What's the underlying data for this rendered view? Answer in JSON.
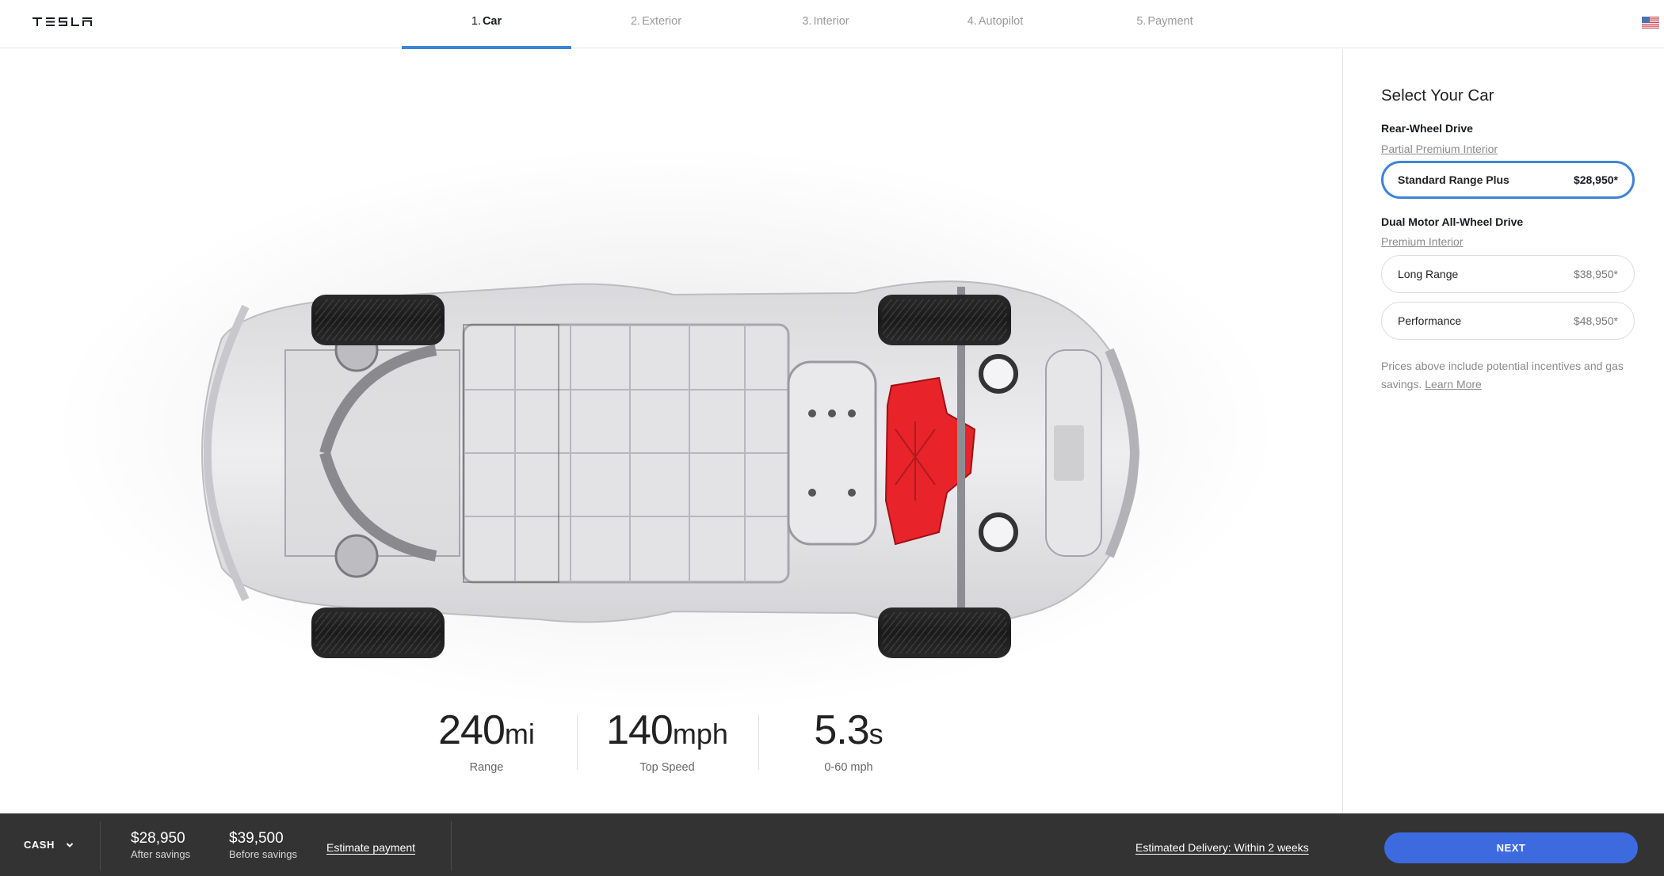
{
  "header": {
    "logo_text": "TESLA",
    "tabs": [
      {
        "num": "1.",
        "label": "Car",
        "active": true
      },
      {
        "num": "2.",
        "label": "Exterior",
        "active": false
      },
      {
        "num": "3.",
        "label": "Interior",
        "active": false
      },
      {
        "num": "4.",
        "label": "Autopilot",
        "active": false
      },
      {
        "num": "5.",
        "label": "Payment",
        "active": false
      }
    ],
    "region_icon": "us-flag-icon"
  },
  "main": {
    "image_alt": "Model 3 chassis top view with rear motor highlighted",
    "stats": [
      {
        "value": "240",
        "unit": "mi",
        "label": "Range"
      },
      {
        "value": "140",
        "unit": "mph",
        "label": "Top Speed"
      },
      {
        "value": "5.3",
        "unit": "s",
        "label": "0-60 mph"
      }
    ]
  },
  "sidebar": {
    "title": "Select Your Car",
    "groups": [
      {
        "heading": "Rear-Wheel Drive",
        "link": "Partial Premium Interior",
        "options": [
          {
            "name": "Standard Range Plus",
            "price": "$28,950*",
            "selected": true
          }
        ]
      },
      {
        "heading": "Dual Motor All-Wheel Drive",
        "link": "Premium Interior",
        "options": [
          {
            "name": "Long Range",
            "price": "$38,950*",
            "selected": false
          },
          {
            "name": "Performance",
            "price": "$48,950*",
            "selected": false
          }
        ]
      }
    ],
    "note": "Prices above include potential incentives and gas savings.",
    "note_link": "Learn More"
  },
  "footer": {
    "payment_type": "CASH",
    "after_savings_amount": "$28,950",
    "after_savings_label": "After savings",
    "before_savings_amount": "$39,500",
    "before_savings_label": "Before savings",
    "estimate_link": "Estimate payment",
    "delivery": "Estimated Delivery: Within 2 weeks",
    "next_label": "NEXT"
  },
  "colors": {
    "accent_blue": "#3e84d6",
    "next_button": "#3e6ae0",
    "footer_bg": "#333333",
    "motor_red": "#e8242a"
  }
}
